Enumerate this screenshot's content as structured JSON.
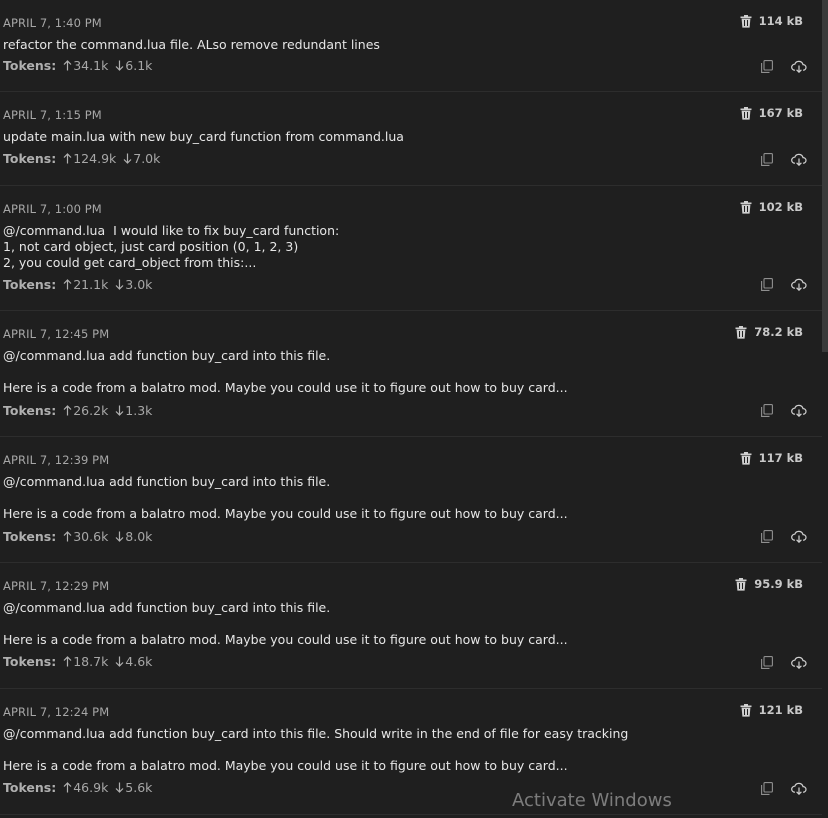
{
  "tokens_label": "Tokens:",
  "tasks": [
    {
      "date": "APRIL 7, 1:40 PM",
      "size": "114 kB",
      "text": "refactor the command.lua file. ALso remove redundant lines",
      "tokens_in": "34.1k",
      "tokens_out": "6.1k"
    },
    {
      "date": "APRIL 7, 1:15 PM",
      "size": "167 kB",
      "text": "update main.lua with new buy_card function from command.lua",
      "tokens_in": "124.9k",
      "tokens_out": "7.0k"
    },
    {
      "date": "APRIL 7, 1:00 PM",
      "size": "102 kB",
      "text": "@/command.lua  I would like to fix buy_card function:\n1, not card object, just card position (0, 1, 2, 3)\n2, you could get card_object from this:...",
      "tokens_in": "21.1k",
      "tokens_out": "3.0k"
    },
    {
      "date": "APRIL 7, 12:45 PM",
      "size": "78.2 kB",
      "text": "@/command.lua add function buy_card into this file.\n\nHere is a code from a balatro mod. Maybe you could use it to figure out how to buy card...",
      "tokens_in": "26.2k",
      "tokens_out": "1.3k"
    },
    {
      "date": "APRIL 7, 12:39 PM",
      "size": "117 kB",
      "text": "@/command.lua add function buy_card into this file.\n\nHere is a code from a balatro mod. Maybe you could use it to figure out how to buy card...",
      "tokens_in": "30.6k",
      "tokens_out": "8.0k"
    },
    {
      "date": "APRIL 7, 12:29 PM",
      "size": "95.9 kB",
      "text": "@/command.lua add function buy_card into this file.\n\nHere is a code from a balatro mod. Maybe you could use it to figure out how to buy card...",
      "tokens_in": "18.7k",
      "tokens_out": "4.6k"
    },
    {
      "date": "APRIL 7, 12:24 PM",
      "size": "121 kB",
      "text": "@/command.lua add function buy_card into this file. Should write in the end of file for easy tracking\n\nHere is a code from a balatro mod. Maybe you could use it to figure out how to buy card...",
      "tokens_in": "46.9k",
      "tokens_out": "5.6k"
    }
  ],
  "icons": {
    "delete": "trash-icon",
    "copy": "copy-icon",
    "export": "cloud-download-icon",
    "up": "arrow-up-icon",
    "down": "arrow-down-icon"
  },
  "watermark": "Activate Windows",
  "colors": {
    "background": "#1f1f1f",
    "divider": "#2d2d2d",
    "text_primary": "#e6e6e6",
    "text_secondary": "#a7a7a7"
  }
}
